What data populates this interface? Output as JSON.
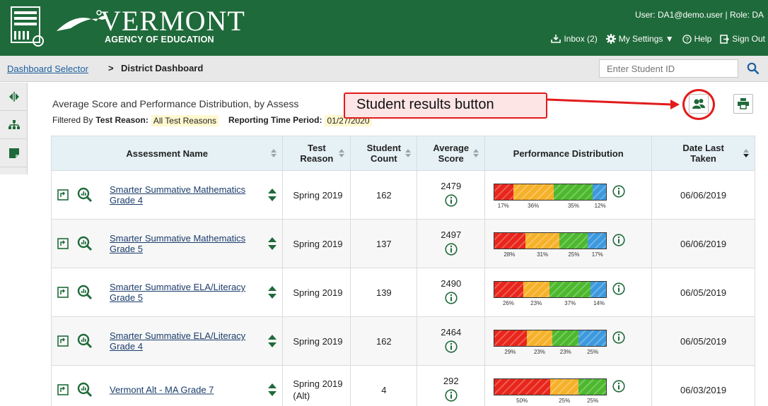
{
  "header": {
    "title": "VERMONT",
    "subtitle": "AGENCY OF EDUCATION",
    "user_line": "User: DA1@demo.user  |  Role: DA",
    "links": [
      {
        "label": "Inbox (2)",
        "icon": "inbox-icon"
      },
      {
        "label": "My Settings ▼",
        "icon": "gear-icon"
      },
      {
        "label": "Help",
        "icon": "help-icon"
      },
      {
        "label": "Sign Out",
        "icon": "sign-out-icon"
      }
    ]
  },
  "breadcrumb": {
    "link": "Dashboard Selector",
    "current": "District Dashboard"
  },
  "search": {
    "placeholder": "Enter Student ID"
  },
  "widget": {
    "title": "Average Score and Performance Distribution, by Assess",
    "filter_prefix": "Filtered By",
    "reason_label": "Test Reason:",
    "reason_value": "All Test Reasons",
    "period_label": "Reporting Time Period:",
    "period_value": "01/27/2020"
  },
  "callout": {
    "text": "Student results button"
  },
  "table": {
    "headers": {
      "name": "Assessment Name",
      "reason": "Test Reason",
      "count": "Student Count",
      "avg": "Average Score",
      "dist": "Performance Distribution",
      "date": "Date Last Taken"
    },
    "rows": [
      {
        "name": "Smarter Summative Mathematics Grade 4",
        "reason": "Spring 2019",
        "count": "162",
        "avg": "2479",
        "dist": [
          17,
          36,
          35,
          12
        ],
        "dist_labels": [
          "17%",
          "36%",
          "35%",
          "12%"
        ],
        "date": "06/06/2019"
      },
      {
        "name": "Smarter Summative Mathematics Grade 5",
        "reason": "Spring 2019",
        "count": "137",
        "avg": "2497",
        "dist": [
          28,
          31,
          25,
          17
        ],
        "dist_labels": [
          "28%",
          "31%",
          "25%",
          "17%"
        ],
        "date": "06/06/2019"
      },
      {
        "name": "Smarter Summative ELA/Literacy Grade 5",
        "reason": "Spring 2019",
        "count": "139",
        "avg": "2490",
        "dist": [
          26,
          23,
          37,
          14
        ],
        "dist_labels": [
          "26%",
          "23%",
          "37%",
          "14%"
        ],
        "date": "06/05/2019"
      },
      {
        "name": "Smarter Summative ELA/Literacy Grade 4",
        "reason": "Spring 2019",
        "count": "162",
        "avg": "2464",
        "dist": [
          29,
          23,
          23,
          25
        ],
        "dist_labels": [
          "29%",
          "23%",
          "23%",
          "25%"
        ],
        "date": "06/05/2019"
      },
      {
        "name": "Vermont Alt - MA Grade 7",
        "reason": "Spring 2019 (Alt)",
        "count": "4",
        "avg": "292",
        "dist": [
          50,
          25,
          25,
          0
        ],
        "dist_labels": [
          "50%",
          "25%",
          "25%"
        ],
        "date": "06/03/2019"
      }
    ]
  },
  "colors": {
    "header_green": "#1f6a3a",
    "level1": "#e8261c",
    "level2": "#f6b12a",
    "level3": "#4cb82e",
    "level4": "#3d99dd",
    "accent_red": "#e21b1b"
  }
}
